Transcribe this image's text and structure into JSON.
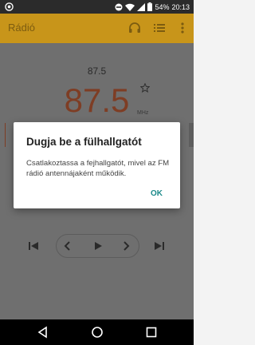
{
  "status_bar": {
    "battery_percent": "54%",
    "time": "20:13",
    "icons": [
      "notification-circle-icon",
      "do-not-disturb-icon",
      "wifi-icon",
      "signal-icon",
      "battery-icon"
    ]
  },
  "app_bar": {
    "title": "Rádió",
    "icons": [
      "headphones-icon",
      "list-icon",
      "more-vert-icon"
    ]
  },
  "tuner": {
    "station_label": "87.5",
    "frequency": "87.5",
    "unit": "MHz"
  },
  "dialog": {
    "title": "Dugja be a fülhallgatót",
    "message": "Csatlakoztassa a fejhallgatót, mivel az FM rádió antennájaként működik.",
    "ok_label": "OK"
  },
  "colors": {
    "app_bar_dimmed": "#c8951a",
    "frequency_dimmed": "#7e3d24",
    "dialog_accent": "#1c8a8a"
  }
}
